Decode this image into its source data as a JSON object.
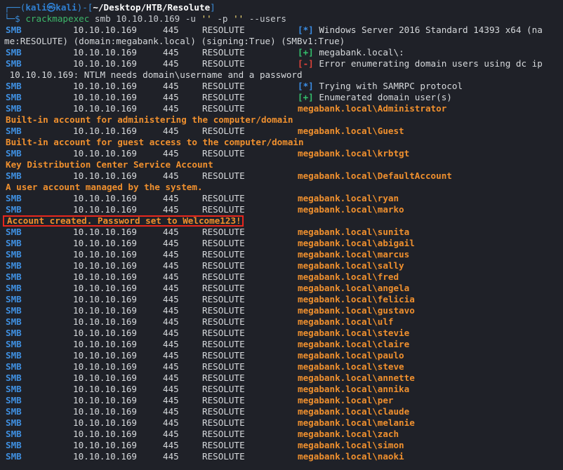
{
  "prompt": {
    "top_frame": "┌──(",
    "user_host": "kali㉿kali",
    "mid_frame": ")-[",
    "path": "~/Desktop/HTB/Resolute",
    "end_frame": "]",
    "bottom_frame": "└─$ ",
    "prog": "crackmapexec",
    "args": " smb 10.10.10.169 -u ",
    "str1": "''",
    "flag2": " -p ",
    "str2": "''",
    "flag3": " --users"
  },
  "common": {
    "proto": "SMB",
    "ip": "10.10.10.169",
    "port": "445",
    "host": "RESOLUTE"
  },
  "rows": [
    {
      "type": "info",
      "tag": "[*]",
      "msg": " Windows Server 2016 Standard 14393 x64 (na"
    },
    {
      "type": "wrap",
      "text": "me:RESOLUTE) (domain:megabank.local) (signing:True) (SMBv1:True)"
    },
    {
      "type": "ok",
      "tag": "[+]",
      "msg": " megabank.local\\:"
    },
    {
      "type": "err",
      "tag": "[-]",
      "msg": " Error enumerating domain users using dc ip"
    },
    {
      "type": "wrap",
      "text": " 10.10.10.169: NTLM needs domain\\username and a password"
    },
    {
      "type": "info",
      "tag": "[*]",
      "msg": " Trying with SAMRPC protocol"
    },
    {
      "type": "ok",
      "tag": "[+]",
      "msg": " Enumerated domain user(s)"
    },
    {
      "type": "user",
      "account": "megabank.local\\Administrator"
    },
    {
      "type": "desc",
      "text": "Built-in account for administering the computer/domain"
    },
    {
      "type": "user",
      "account": "megabank.local\\Guest"
    },
    {
      "type": "desc",
      "text": "Built-in account for guest access to the computer/domain"
    },
    {
      "type": "user",
      "account": "megabank.local\\krbtgt"
    },
    {
      "type": "desc",
      "text": "Key Distribution Center Service Account"
    },
    {
      "type": "user",
      "account": "megabank.local\\DefaultAccount"
    },
    {
      "type": "desc",
      "text": "A user account managed by the system."
    },
    {
      "type": "user",
      "account": "megabank.local\\ryan"
    },
    {
      "type": "user",
      "account": "megabank.local\\marko"
    },
    {
      "type": "desc-highlight",
      "text": "Account created. Password set to Welcome123!"
    },
    {
      "type": "user",
      "account": "megabank.local\\sunita"
    },
    {
      "type": "user",
      "account": "megabank.local\\abigail"
    },
    {
      "type": "user",
      "account": "megabank.local\\marcus"
    },
    {
      "type": "user",
      "account": "megabank.local\\sally"
    },
    {
      "type": "user",
      "account": "megabank.local\\fred"
    },
    {
      "type": "user",
      "account": "megabank.local\\angela"
    },
    {
      "type": "user",
      "account": "megabank.local\\felicia"
    },
    {
      "type": "user",
      "account": "megabank.local\\gustavo"
    },
    {
      "type": "user",
      "account": "megabank.local\\ulf"
    },
    {
      "type": "user",
      "account": "megabank.local\\stevie"
    },
    {
      "type": "user",
      "account": "megabank.local\\claire"
    },
    {
      "type": "user",
      "account": "megabank.local\\paulo"
    },
    {
      "type": "user",
      "account": "megabank.local\\steve"
    },
    {
      "type": "user",
      "account": "megabank.local\\annette"
    },
    {
      "type": "user",
      "account": "megabank.local\\annika"
    },
    {
      "type": "user",
      "account": "megabank.local\\per"
    },
    {
      "type": "user",
      "account": "megabank.local\\claude"
    },
    {
      "type": "user",
      "account": "megabank.local\\melanie"
    },
    {
      "type": "user",
      "account": "megabank.local\\zach"
    },
    {
      "type": "user",
      "account": "megabank.local\\simon"
    },
    {
      "type": "user",
      "account": "megabank.local\\naoki"
    }
  ]
}
